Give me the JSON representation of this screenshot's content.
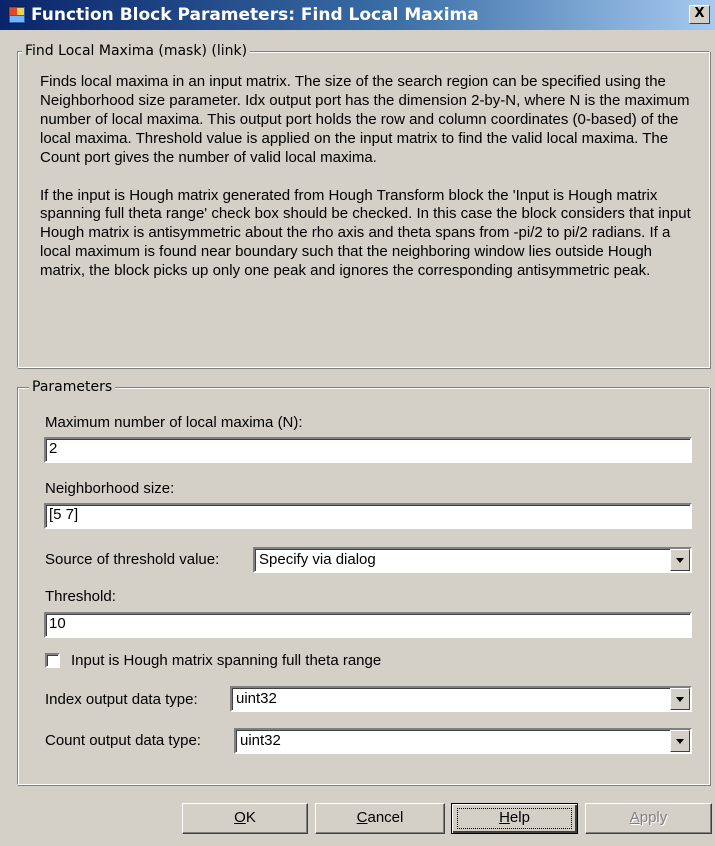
{
  "window": {
    "title": "Function Block Parameters: Find Local Maxima",
    "close_glyph": "X",
    "icon": "simulink-block-icon"
  },
  "description_group": {
    "legend": "Find Local Maxima (mask) (link)",
    "paragraph1": "Finds local maxima in an input matrix. The size of the search region can be specified using the Neighborhood size parameter. Idx output port has the dimension 2-by-N, where N is the maximum number of local maxima. This output port holds the row and column coordinates (0-based) of the local maxima. Threshold value is applied on the input matrix to find the valid local maxima. The Count port gives the number of valid local maxima.",
    "paragraph2": "If the input is Hough matrix generated from Hough Transform block the 'Input is Hough matrix spanning full theta range' check box should be checked. In this case the block considers that input Hough matrix is antisymmetric about the rho axis and theta spans from -pi/2 to pi/2 radians. If a local maximum is found near boundary such that the neighboring window lies outside Hough matrix, the block picks up only one peak and ignores the corresponding antisymmetric peak."
  },
  "parameters_group": {
    "legend": "Parameters",
    "max_local_maxima": {
      "label": "Maximum number of local maxima (N):",
      "value": "2"
    },
    "neighborhood_size": {
      "label": "Neighborhood size:",
      "value": "[5 7]"
    },
    "threshold_source": {
      "label": "Source of threshold value:",
      "value": "Specify via dialog"
    },
    "threshold": {
      "label": "Threshold:",
      "value": "10"
    },
    "hough_checkbox": {
      "label": "Input is Hough matrix spanning full theta range",
      "checked": false
    },
    "index_output_type": {
      "label": "Index output data type:",
      "value": "uint32"
    },
    "count_output_type": {
      "label": "Count output data type:",
      "value": "uint32"
    }
  },
  "buttons": {
    "ok": {
      "underline": "O",
      "rest": "K"
    },
    "cancel": {
      "underline": "C",
      "rest": "ancel"
    },
    "help": {
      "underline": "H",
      "rest": "elp"
    },
    "apply": {
      "underline": "A",
      "rest": "pply"
    }
  },
  "colors": {
    "face": "#d4d0c8",
    "title_start": "#0a246a",
    "title_end": "#a6caf0"
  }
}
